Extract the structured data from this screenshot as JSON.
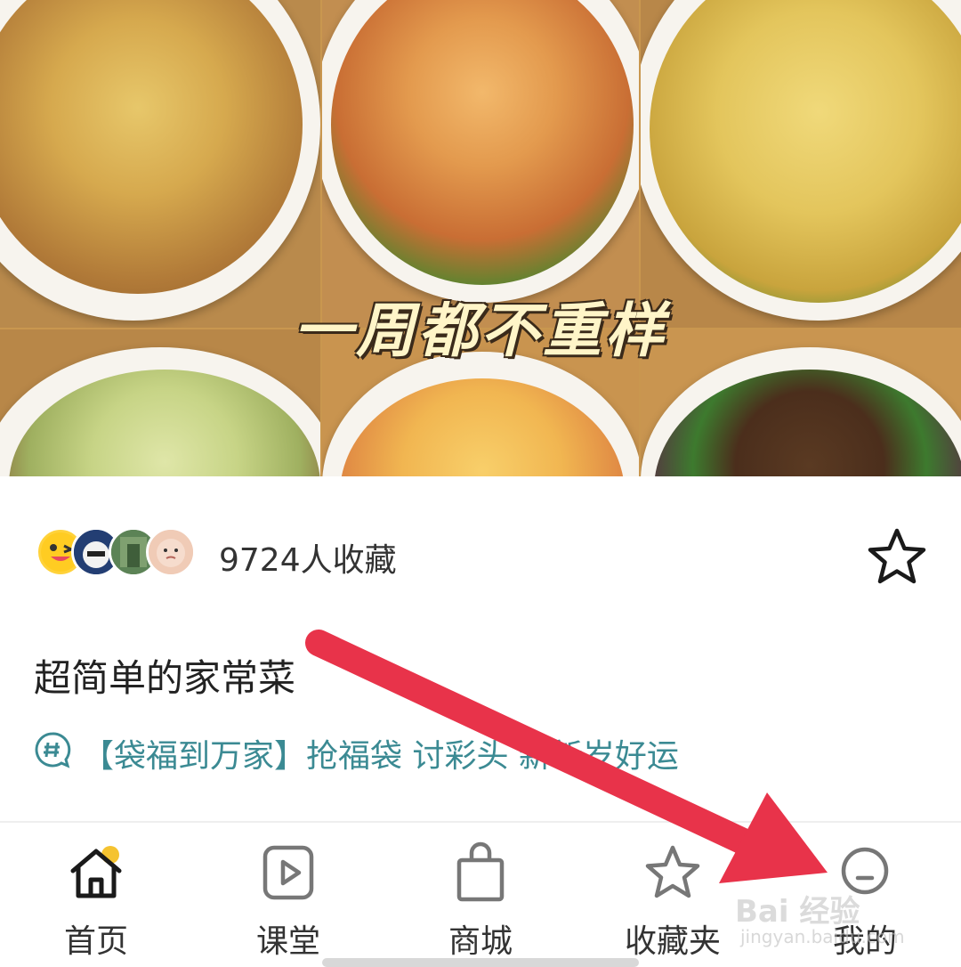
{
  "hero": {
    "caption": "一周都不重样"
  },
  "collect": {
    "count_text": "9724人收藏"
  },
  "recipe": {
    "title": "超简单的家常菜",
    "topic": "【袋福到万家】抢福袋 讨彩头 新新岁好运"
  },
  "nav": {
    "items": [
      {
        "label": "首页",
        "icon": "home-icon"
      },
      {
        "label": "课堂",
        "icon": "play-icon"
      },
      {
        "label": "商城",
        "icon": "shopping-bag-icon"
      },
      {
        "label": "收藏夹",
        "icon": "star-icon"
      },
      {
        "label": "我的",
        "icon": "profile-icon"
      }
    ]
  },
  "watermark": {
    "brand": "Bai 经验",
    "url": "jingyan.baidu.com"
  },
  "colors": {
    "accent_arrow": "#e8334a",
    "topic_teal": "#3b8a93",
    "home_dot": "#f5c330"
  }
}
